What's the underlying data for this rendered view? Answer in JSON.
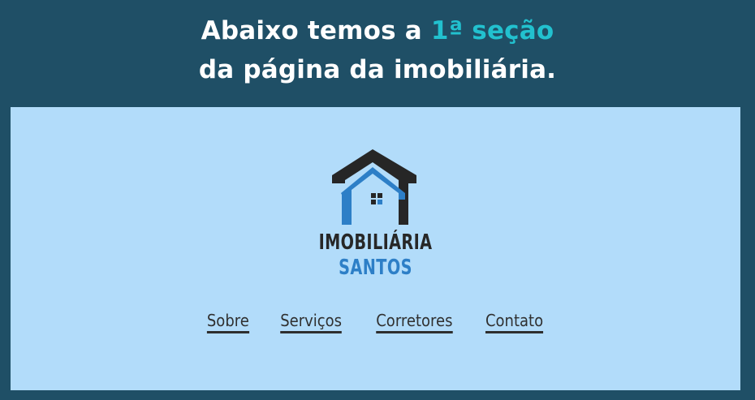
{
  "heading": {
    "line1_before": "Abaixo temos a ",
    "line1_accent": "1ª seção",
    "line2": "da página da imobiliária."
  },
  "logo": {
    "name_line1": "IMOBILIÁRIA",
    "name_line2": "SANTOS",
    "icon": "house-icon"
  },
  "nav": {
    "items": [
      {
        "label": "Sobre"
      },
      {
        "label": "Serviços"
      },
      {
        "label": "Corretores"
      },
      {
        "label": "Contato"
      }
    ]
  },
  "colors": {
    "page_background": "#1f4f66",
    "accent": "#22c1cf",
    "section_background": "#b2dcfa",
    "logo_dark": "#272727",
    "logo_blue": "#2d7fc7"
  }
}
